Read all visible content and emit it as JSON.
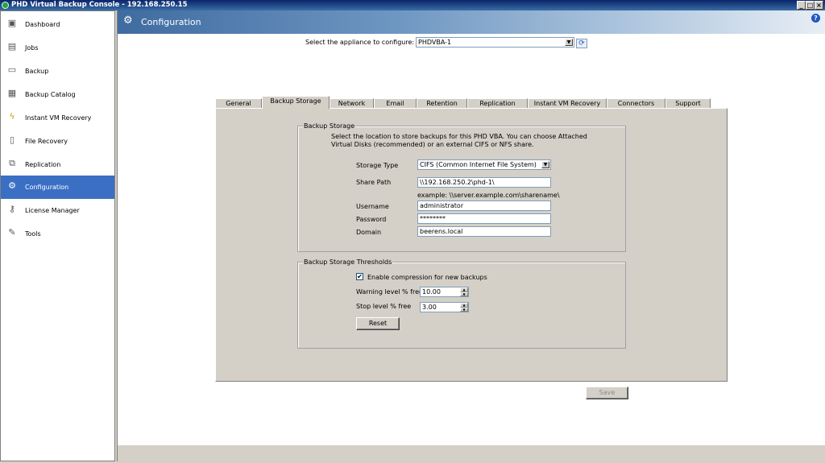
{
  "window": {
    "title": "PHD Virtual Backup Console - 192.168.250.15"
  },
  "sidebar": {
    "items": [
      {
        "label": "Dashboard",
        "icon": "dashboard-icon"
      },
      {
        "label": "Jobs",
        "icon": "jobs-icon"
      },
      {
        "label": "Backup",
        "icon": "backup-icon"
      },
      {
        "label": "Backup Catalog",
        "icon": "catalog-icon"
      },
      {
        "label": "Instant VM Recovery",
        "icon": "lightning-icon"
      },
      {
        "label": "File Recovery",
        "icon": "file-icon"
      },
      {
        "label": "Replication",
        "icon": "replication-icon"
      },
      {
        "label": "Configuration",
        "icon": "gear-icon"
      },
      {
        "label": "License Manager",
        "icon": "key-icon"
      },
      {
        "label": "Tools",
        "icon": "wrench-icon"
      }
    ],
    "active": "Configuration"
  },
  "header": {
    "title": "Configuration",
    "help": "?"
  },
  "appliance": {
    "label": "Select the appliance to configure:",
    "value": "PHDVBA-1"
  },
  "tabs": [
    "General",
    "Backup Storage",
    "Network",
    "Email",
    "Retention",
    "Replication",
    "Instant VM Recovery",
    "Connectors",
    "Support"
  ],
  "active_tab": "Backup Storage",
  "backup_storage": {
    "legend": "Backup Storage",
    "description": "Select the location to store backups for this PHD VBA. You can choose Attached Virtual Disks (recommended) or an external CIFS or NFS share.",
    "storage_type_label": "Storage Type",
    "storage_type_value": "CIFS (Common Internet File System)",
    "share_path_label": "Share Path",
    "share_path_value": "\\\\192.168.250.2\\phd-1\\",
    "share_path_example": "example: \\\\server.example.com\\sharename\\",
    "username_label": "Username",
    "username_value": "administrator",
    "password_label": "Password",
    "password_value": "********",
    "domain_label": "Domain",
    "domain_value": "beerens.local"
  },
  "thresholds": {
    "legend": "Backup Storage Thresholds",
    "compression_label": "Enable compression for new backups",
    "compression_checked": true,
    "check_mark": "✔",
    "warning_label": "Warning level % free",
    "warning_value": "10.00",
    "stop_label": "Stop level % free",
    "stop_value": "3.00",
    "reset_label": "Reset"
  },
  "save_label": "Save",
  "glyphs": {
    "dropdown": "▼",
    "spin_up": "▲",
    "spin_down": "▼",
    "refresh": "⟳",
    "minimize": "_",
    "maximize": "□",
    "close": "×",
    "gear": "⚙"
  }
}
